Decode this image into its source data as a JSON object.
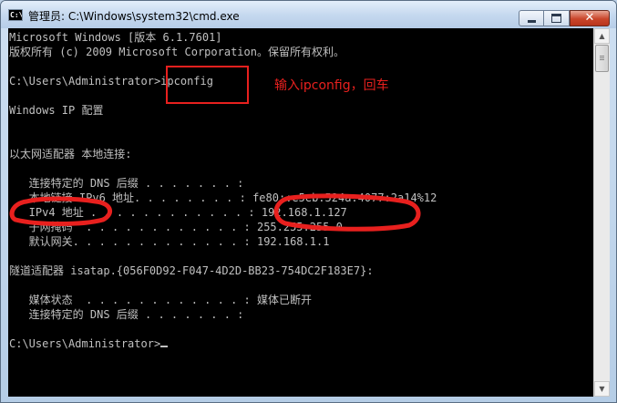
{
  "window": {
    "title": "管理员: C:\\Windows\\system32\\cmd.exe",
    "icon_text": "C:\\"
  },
  "controls": {
    "minimize": "minimize",
    "maximize": "maximize",
    "close_glyph": "✕"
  },
  "console": {
    "lines": [
      "Microsoft Windows [版本 6.1.7601]",
      "版权所有 (c) 2009 Microsoft Corporation。保留所有权利。",
      "",
      "C:\\Users\\Administrator>ipconfig",
      "",
      "Windows IP 配置",
      "",
      "",
      "以太网适配器 本地连接:",
      "",
      "   连接特定的 DNS 后缀 . . . . . . . :",
      "   本地链接 IPv6 地址. . . . . . . . : fe80::e5eb:524a:4077:2a14%12",
      "   IPv4 地址 . . . . . . . . . . . . : 192.168.1.127",
      "   子网掩码  . . . . . . . . . . . . : 255.255.255.0",
      "   默认网关. . . . . . . . . . . . . : 192.168.1.1",
      "",
      "隧道适配器 isatap.{056F0D92-F047-4D2D-BB23-754DC2F183E7}:",
      "",
      "   媒体状态  . . . . . . . . . . . . : 媒体已断开",
      "   连接特定的 DNS 后缀 . . . . . . . :",
      "",
      "C:\\Users\\Administrator>"
    ]
  },
  "annotation": {
    "text": "输入ipconfig，回车",
    "color": "#e8201e"
  },
  "scrollbar": {
    "up_icon": "▲",
    "down_icon": "▼"
  }
}
